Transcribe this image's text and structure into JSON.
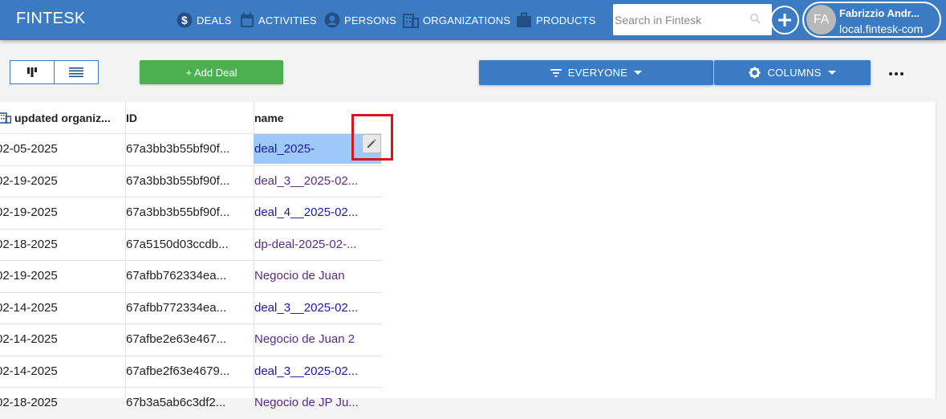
{
  "app": {
    "brand": "FINTESK"
  },
  "nav": {
    "deals": "DEALS",
    "activities": "ACTIVITIES",
    "persons": "PERSONS",
    "organizations": "ORGANIZATIONS",
    "products": "PRODUCTS"
  },
  "search": {
    "placeholder": "Search in Fintesk",
    "value": ""
  },
  "user": {
    "initials": "FA",
    "name": "Fabrizzio Andr...",
    "host": "local.fintesk-com"
  },
  "toolbar": {
    "add_deal": "+ Add Deal",
    "filter_label": "EVERYONE",
    "columns_label": "COLUMNS"
  },
  "table": {
    "headers": {
      "updated": "updated organiz...",
      "id": "ID",
      "name": "name"
    },
    "rows": [
      {
        "date": "02-05-2025",
        "id": "67a3bb3b55bf90f...",
        "name": "deal_2025-",
        "link": false
      },
      {
        "date": "02-19-2025",
        "id": "67a3bb3b55bf90f...",
        "name": "deal_3__2025-02...",
        "link": false
      },
      {
        "date": "02-19-2025",
        "id": "67a3bb3b55bf90f...",
        "name": "deal_4__2025-02...",
        "link": true
      },
      {
        "date": "02-18-2025",
        "id": "67a5150d03ccdb...",
        "name": "dp-deal-2025-02-...",
        "link": false
      },
      {
        "date": "02-19-2025",
        "id": "67afbb762334ea...",
        "name": "Negocio de Juan",
        "link": false
      },
      {
        "date": "02-14-2025",
        "id": "67afbb772334ea...",
        "name": "deal_3__2025-02...",
        "link": true
      },
      {
        "date": "02-14-2025",
        "id": "67afbe2e63e467...",
        "name": "Negocio de Juan 2",
        "link": false
      },
      {
        "date": "02-14-2025",
        "id": "67afbe2f63e4679...",
        "name": "deal_3__2025-02...",
        "link": true
      },
      {
        "date": "02-18-2025",
        "id": "67b3a5ab6c3df2...",
        "name": "Negocio de JP Ju...",
        "link": false
      }
    ]
  },
  "colors": {
    "primary": "#3b7bc4",
    "success": "#4caf50",
    "highlight": "#d9151b",
    "selection": "#9cc9f7"
  }
}
